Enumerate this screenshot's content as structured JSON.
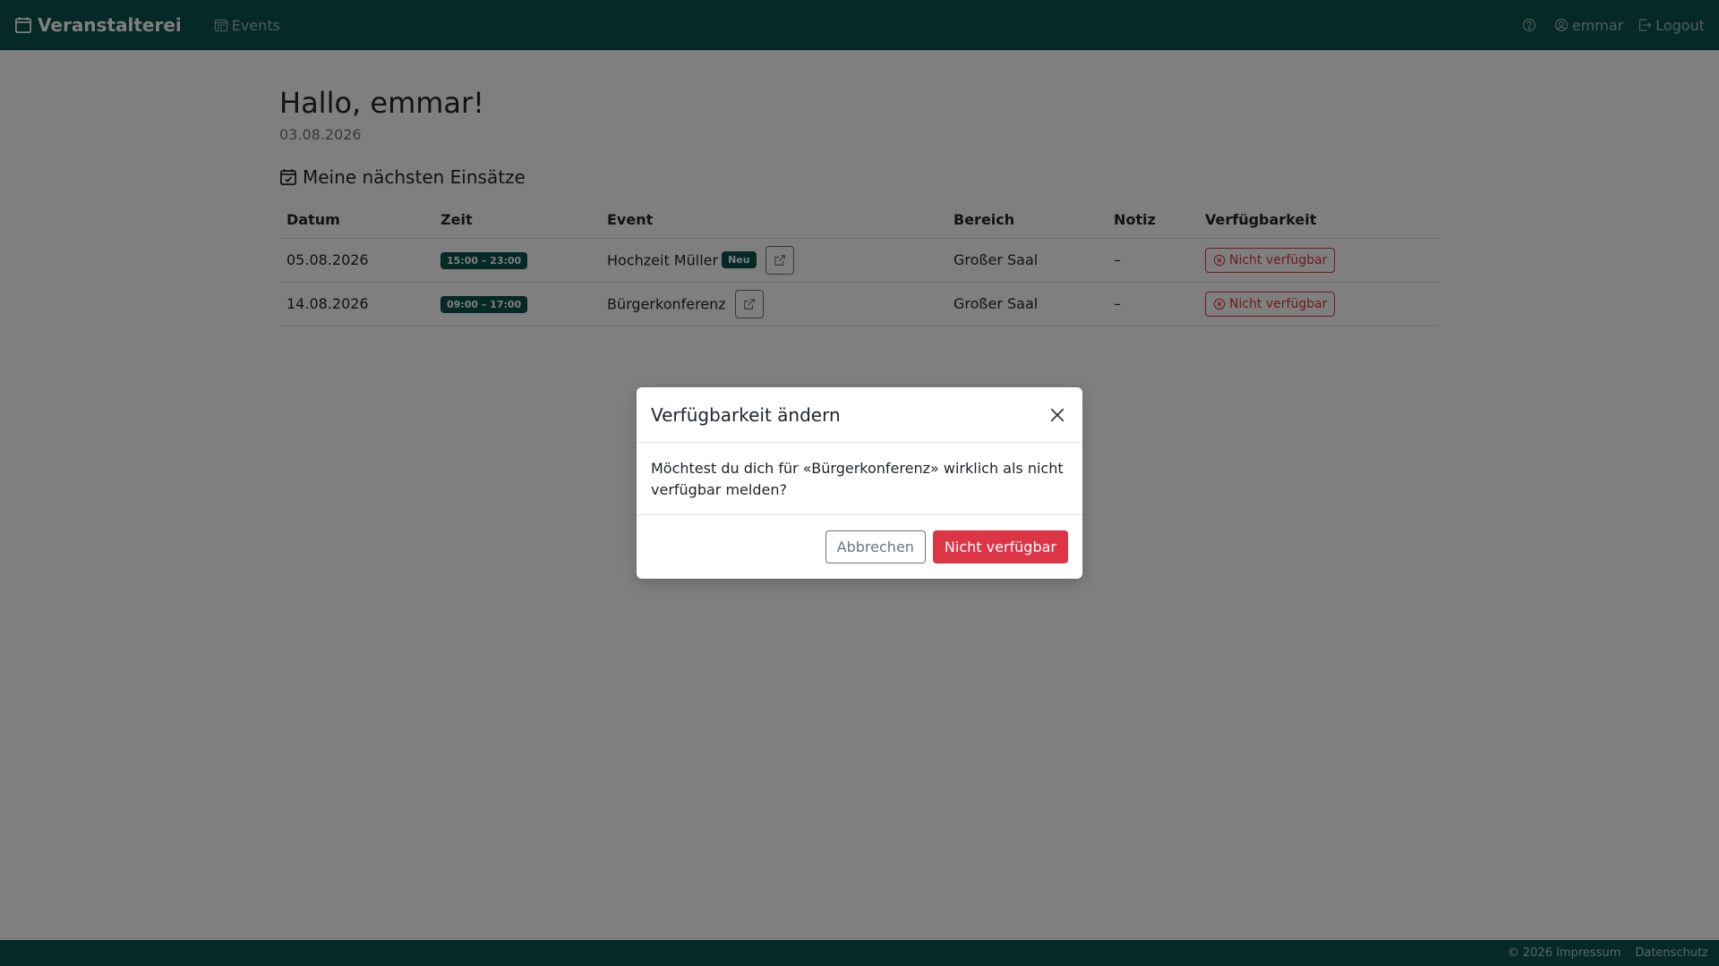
{
  "navbar": {
    "brand": "Veranstalterei",
    "brand_icon": "calendar-icon",
    "events_label": "Events",
    "user_label": "emmar",
    "logout_label": "Logout"
  },
  "main": {
    "greeting": "Hallo, emmar!",
    "date": "03.08.2026",
    "section_title": "Meine nächsten Einsätze",
    "table": {
      "headers": [
        "Datum",
        "Zeit",
        "Event",
        "Bereich",
        "Notiz",
        "Verfügbarkeit"
      ],
      "rows": [
        {
          "date": "05.08.2026",
          "time": "15:00 – 23:00",
          "event": "Hochzeit Müller",
          "event_badge": "Neu",
          "area": "Großer Saal",
          "note": "–",
          "availability": "Nicht verfügbar"
        },
        {
          "date": "14.08.2026",
          "time": "09:00 – 17:00",
          "event": "Bürgerkonferenz",
          "area": "Großer Saal",
          "note": "–",
          "availability": "Nicht verfügbar"
        }
      ]
    }
  },
  "modal": {
    "title": "Verfügbarkeit ändern",
    "body": "Möchtest du dich für «Bürgerkonferenz» wirklich als nicht verfügbar melden?",
    "cancel_label": "Abbrechen",
    "confirm_label": "Nicht verfügbar"
  },
  "footer": {
    "copyright": "© 2026 Impressum",
    "privacy": "Datenschutz"
  },
  "colors": {
    "brand": "#0a524b",
    "danger": "#dc3545",
    "secondary": "#6c757d"
  }
}
